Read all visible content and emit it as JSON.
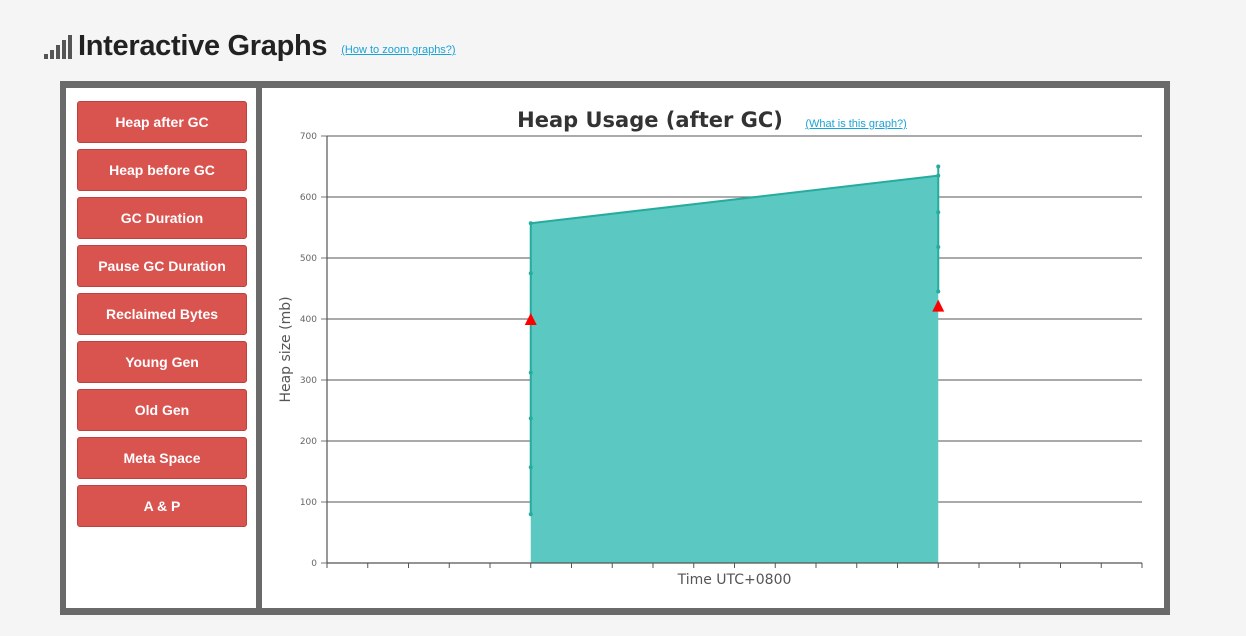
{
  "header": {
    "icon": "signal-bars-icon",
    "title": "Interactive Graphs",
    "zoom_link": "(How to zoom graphs?)"
  },
  "sidebar": {
    "buttons": [
      {
        "label": "Heap after GC"
      },
      {
        "label": "Heap before GC"
      },
      {
        "label": "GC Duration"
      },
      {
        "label": "Pause GC Duration"
      },
      {
        "label": "Reclaimed Bytes"
      },
      {
        "label": "Young Gen"
      },
      {
        "label": "Old Gen"
      },
      {
        "label": "Meta Space"
      },
      {
        "label": "A & P"
      }
    ]
  },
  "chart": {
    "help_link": "(What is this graph?)"
  },
  "colors": {
    "button": "#d9534f",
    "area_fill": "#5bc8c1",
    "area_line": "#26ab9f",
    "marker": "#ff0000"
  },
  "chart_data": {
    "type": "area",
    "title": "Heap Usage (after GC)",
    "xlabel": "Time UTC+0800",
    "ylabel": "Heap size (mb)",
    "ylim": [
      0,
      700
    ],
    "yticks": [
      "0",
      "100",
      "200",
      "300",
      "400",
      "500",
      "600",
      "700"
    ],
    "x_ticks_count": 21,
    "x": [
      5,
      15
    ],
    "xlim": [
      0,
      20
    ],
    "values": [
      557,
      635
    ],
    "vertical_points": [
      {
        "x": 5,
        "values": [
          80,
          157,
          237,
          312,
          398,
          475,
          557
        ]
      },
      {
        "x": 15,
        "values": [
          445,
          518,
          575,
          635,
          650
        ]
      }
    ],
    "markers": [
      {
        "x": 5,
        "value": 400
      },
      {
        "x": 15,
        "value": 422
      }
    ],
    "grid": true
  }
}
